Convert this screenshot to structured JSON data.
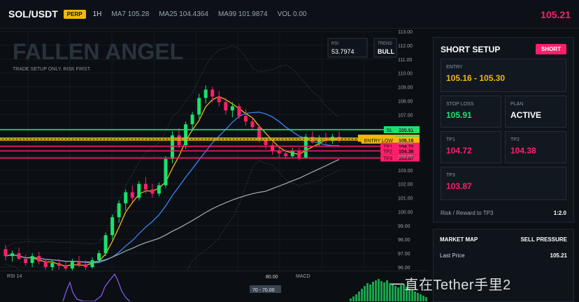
{
  "header": {
    "symbol": "SOL/USDT",
    "badge": "PERP",
    "timeframe": "1H",
    "ma7": "MA7 105.28",
    "ma25": "MA25 104.4364",
    "ma99": "MA99 101.9874",
    "vol": "VOL 0.00",
    "price": "105.21"
  },
  "chart_overlay": {
    "title": "FALLEN ANGEL",
    "subtitle": "TRADE SETUP ONLY. RISK FIRST.",
    "rsi_label": "RSI",
    "rsi_value": "53.7974",
    "trend_label": "TREND",
    "trend_value": "BULL"
  },
  "chart_data": {
    "type": "candlestick",
    "y_ticks": [
      "113.00",
      "112.00",
      "111.00",
      "110.00",
      "109.00",
      "108.00",
      "107.00",
      "106.00",
      "105.00",
      "104.00",
      "103.00",
      "102.00",
      "101.00",
      "100.00",
      "99.00",
      "98.00",
      "97.00",
      "96.00"
    ],
    "ylim": [
      96,
      113
    ],
    "levels": [
      {
        "name": "SL",
        "label": "SL",
        "value": 105.91,
        "color": "#19e36b"
      },
      {
        "name": "ENTRY HIGH",
        "label": "ENTRY HIGH",
        "value": 105.3,
        "color": "#f0b90b"
      },
      {
        "name": "PRICE",
        "label": "",
        "value": 105.21,
        "color": "#19e36b"
      },
      {
        "name": "ENTRY LOW",
        "label": "ENTRY LOW",
        "value": 105.16,
        "color": "#f0b90b"
      },
      {
        "name": "TP1",
        "label": "TP1",
        "value": 104.72,
        "color": "#ff1f6b"
      },
      {
        "name": "TP2",
        "label": "TP2",
        "value": 104.38,
        "color": "#ff1f6b"
      },
      {
        "name": "TP3",
        "label": "TP3",
        "value": 103.87,
        "color": "#ff1f6b"
      }
    ],
    "candles": [
      [
        97.3,
        97.6,
        96.5,
        96.8
      ],
      [
        96.8,
        97.2,
        96.4,
        97.0
      ],
      [
        97.0,
        97.4,
        96.5,
        96.6
      ],
      [
        96.6,
        96.9,
        96.1,
        96.3
      ],
      [
        96.3,
        97.0,
        96.0,
        96.8
      ],
      [
        96.8,
        97.1,
        96.2,
        96.4
      ],
      [
        96.4,
        96.6,
        95.8,
        96.0
      ],
      [
        96.0,
        96.5,
        95.7,
        96.3
      ],
      [
        96.3,
        96.6,
        95.8,
        96.1
      ],
      [
        96.1,
        96.4,
        95.6,
        95.9
      ],
      [
        95.9,
        96.6,
        95.7,
        96.4
      ],
      [
        96.4,
        96.8,
        96.0,
        96.2
      ],
      [
        96.2,
        96.5,
        95.8,
        96.0
      ],
      [
        96.0,
        96.7,
        95.9,
        96.5
      ],
      [
        96.5,
        97.2,
        96.3,
        97.0
      ],
      [
        97.0,
        98.5,
        96.8,
        98.3
      ],
      [
        98.3,
        99.8,
        98.0,
        99.6
      ],
      [
        99.6,
        100.8,
        99.2,
        100.6
      ],
      [
        100.6,
        101.6,
        100.1,
        101.4
      ],
      [
        101.4,
        101.9,
        100.7,
        101.0
      ],
      [
        101.0,
        102.2,
        100.8,
        102.0
      ],
      [
        102.0,
        102.5,
        101.3,
        101.6
      ],
      [
        101.6,
        102.0,
        101.0,
        101.3
      ],
      [
        101.3,
        102.1,
        101.1,
        101.9
      ],
      [
        101.9,
        104.0,
        101.7,
        103.8
      ],
      [
        103.8,
        105.8,
        103.5,
        105.5
      ],
      [
        105.5,
        106.0,
        104.6,
        104.8
      ],
      [
        104.8,
        106.5,
        104.5,
        106.3
      ],
      [
        106.3,
        107.2,
        105.8,
        107.0
      ],
      [
        107.0,
        108.5,
        106.7,
        108.2
      ],
      [
        108.2,
        109.1,
        107.8,
        108.8
      ],
      [
        108.8,
        109.0,
        107.9,
        108.3
      ],
      [
        108.3,
        108.7,
        107.6,
        107.9
      ],
      [
        107.9,
        108.2,
        107.0,
        107.3
      ],
      [
        107.3,
        107.9,
        106.8,
        107.6
      ],
      [
        107.6,
        107.8,
        106.7,
        106.9
      ],
      [
        106.9,
        107.4,
        106.2,
        106.5
      ],
      [
        106.5,
        106.8,
        105.9,
        106.1
      ],
      [
        106.1,
        106.3,
        105.0,
        105.2
      ],
      [
        105.2,
        105.4,
        104.5,
        104.8
      ],
      [
        104.8,
        105.0,
        104.1,
        104.4
      ],
      [
        104.4,
        104.7,
        103.9,
        104.2
      ],
      [
        104.2,
        104.5,
        103.8,
        104.0
      ],
      [
        104.0,
        104.6,
        103.9,
        104.4
      ],
      [
        104.4,
        104.6,
        103.7,
        103.9
      ],
      [
        103.9,
        105.6,
        103.8,
        105.4
      ],
      [
        105.4,
        105.8,
        104.9,
        105.0
      ],
      [
        105.0,
        105.5,
        104.7,
        105.3
      ],
      [
        105.3,
        105.7,
        104.9,
        105.1
      ],
      [
        105.1,
        105.6,
        104.9,
        105.4
      ],
      [
        105.4,
        105.8,
        105.0,
        105.21
      ]
    ]
  },
  "setup": {
    "title": "SHORT SETUP",
    "button": "SHORT",
    "entry_label": "ENTRY",
    "entry_value": "105.16 - 105.30",
    "stop_label": "STOP LOSS",
    "stop_value": "105.91",
    "plan_label": "PLAN",
    "plan_value": "ACTIVE",
    "tp1_label": "TP1",
    "tp1_value": "104.72",
    "tp2_label": "TP2",
    "tp2_value": "104.38",
    "tp3_label": "TP3",
    "tp3_value": "103.87",
    "rr_label": "Risk / Reward to TP3",
    "rr_value": "1:2.0"
  },
  "market_map": {
    "title": "MARKET MAP",
    "pressure": "SELL PRESSURE",
    "last_price_label": "Last Price",
    "last_price_value": "105.21"
  },
  "sub_panels": {
    "rsi_label": "RSI 14",
    "level_80": "80.00",
    "level_70": "70 - 70.00",
    "macd_label": "MACD"
  },
  "watermark": "一直在Tether手里2",
  "colors": {
    "accent": "#ff1f6b",
    "green": "#19e36b",
    "yellow": "#f0b90b",
    "blue": "#3b82f6"
  }
}
